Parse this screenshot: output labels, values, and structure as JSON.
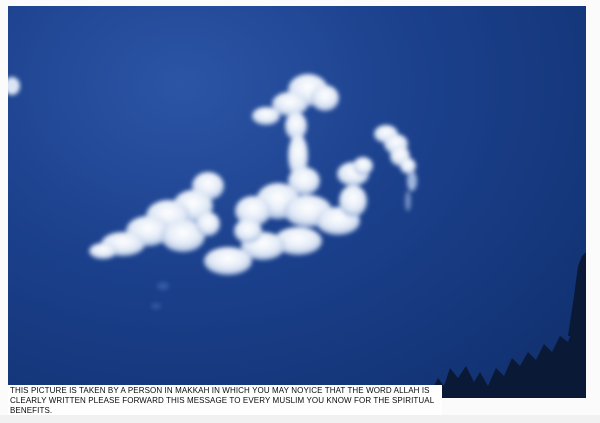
{
  "caption": {
    "text": "THIS PICTURE IS TAKEN BY A PERSON IN MAKKAH IN WHICH YOU MAY NOYICE THAT THE WORD ALLAH IS CLEARLY WRITTEN PLEASE FORWARD THIS MESSAGE TO EVERY MUSLIM YOU KNOW FOR THE SPIRITUAL BENEFITS."
  },
  "photo": {
    "subject": "white-clouds-in-blue-sky",
    "colors": {
      "sky": "#1c418d",
      "cloud": "#e8eef8",
      "tree_silhouette": "#0a1a36"
    }
  }
}
